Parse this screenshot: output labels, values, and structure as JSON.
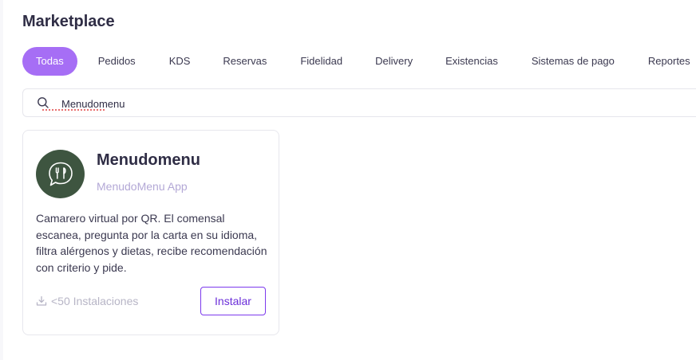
{
  "page": {
    "title": "Marketplace"
  },
  "tabs": [
    {
      "label": "Todas",
      "active": true
    },
    {
      "label": "Pedidos"
    },
    {
      "label": "KDS"
    },
    {
      "label": "Reservas"
    },
    {
      "label": "Fidelidad"
    },
    {
      "label": "Delivery"
    },
    {
      "label": "Existencias"
    },
    {
      "label": "Sistemas de pago"
    },
    {
      "label": "Reportes"
    }
  ],
  "search": {
    "value": "Menudomenu",
    "icon": "search-icon"
  },
  "app": {
    "name": "Menudomenu",
    "subtitle": "MenudoMenu App",
    "description": "Camarero virtual por QR. El comensal escanea, pregunta por la carta en su idioma, filtra alérgenos y dietas, recibe recomendación con criterio y pide.",
    "installs": "<50 Instalaciones",
    "install_label": "Instalar",
    "logo_color": "#3e5540"
  },
  "colors": {
    "accent": "#a66ef5",
    "button_border": "#7c3aed"
  }
}
